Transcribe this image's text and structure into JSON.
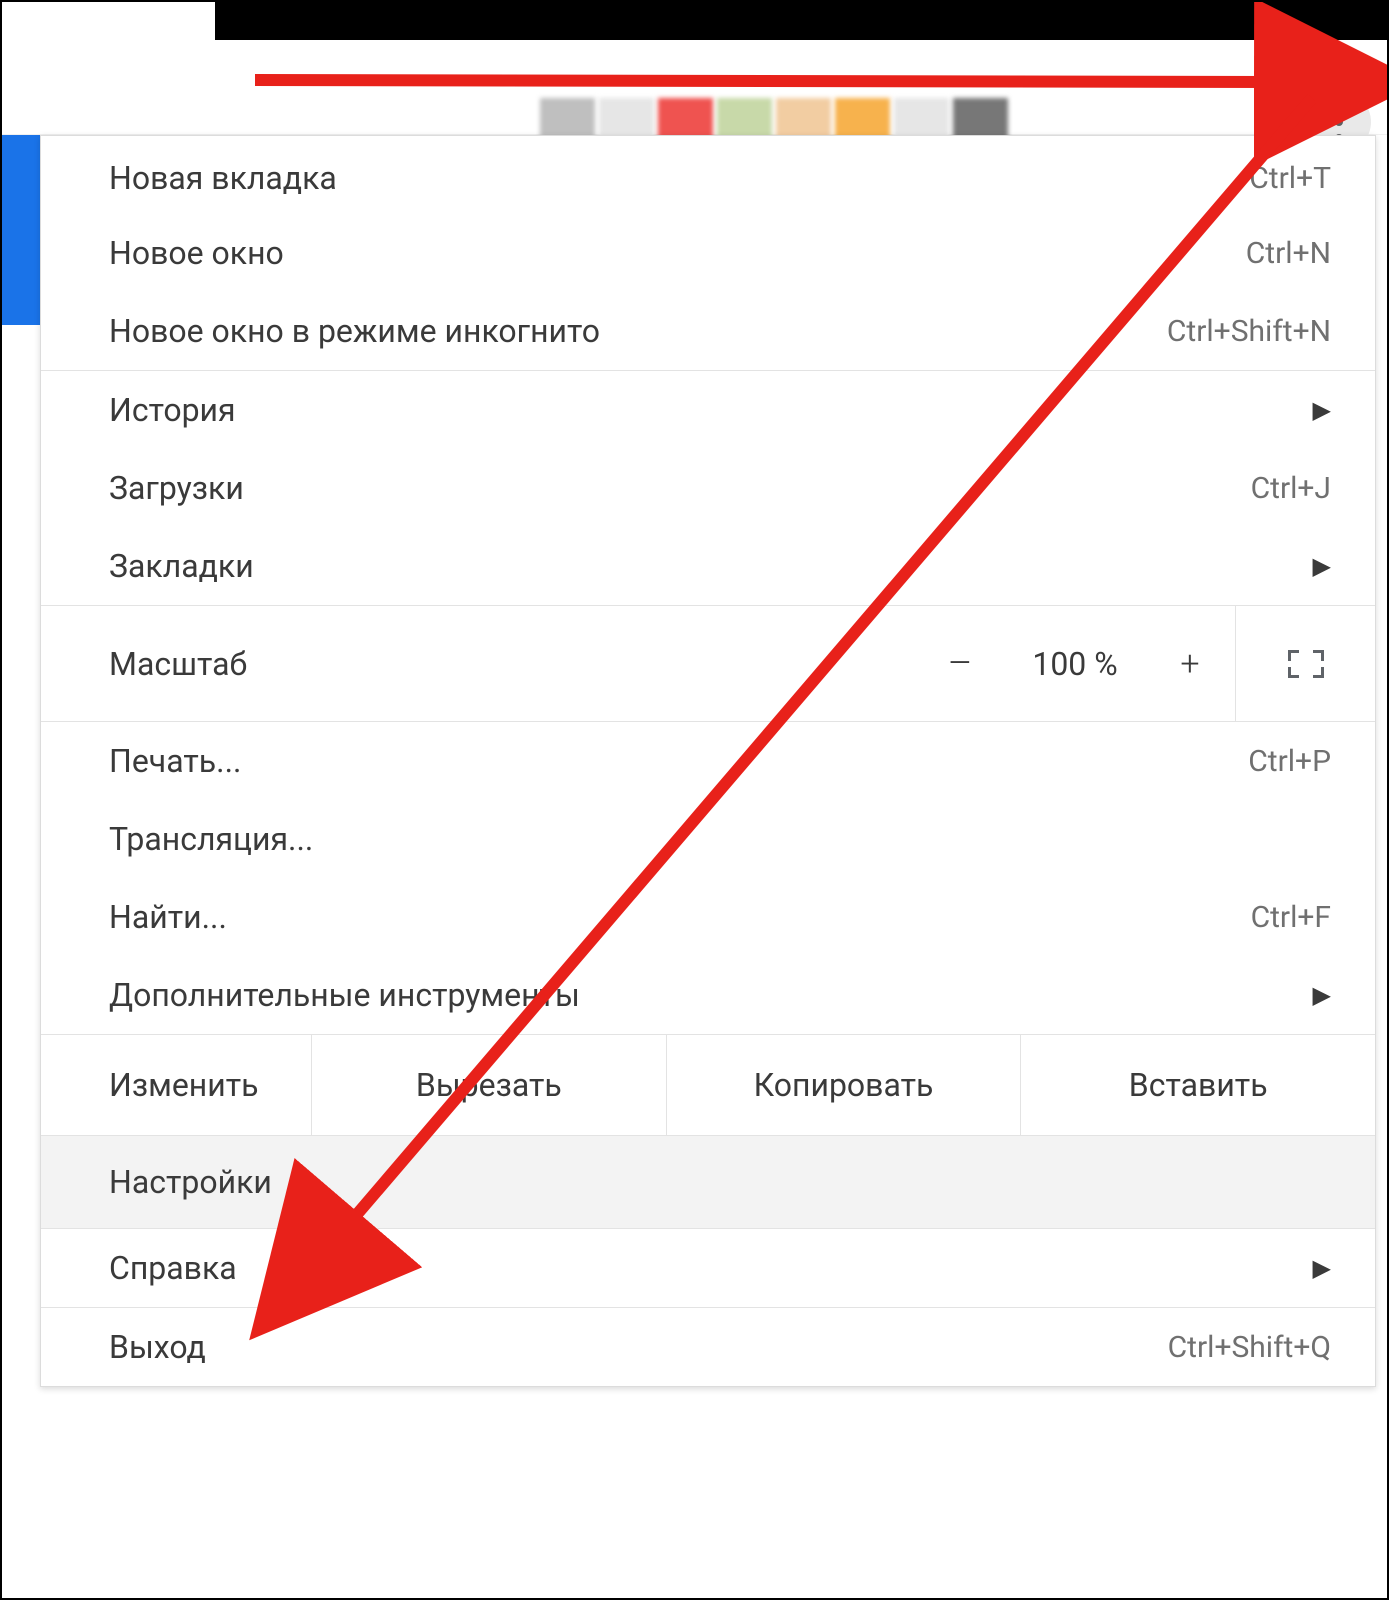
{
  "menu": {
    "new_tab": {
      "label": "Новая вкладка",
      "shortcut": "Ctrl+T"
    },
    "new_window": {
      "label": "Новое окно",
      "shortcut": "Ctrl+N"
    },
    "incognito": {
      "label": "Новое окно в режиме инкогнито",
      "shortcut": "Ctrl+Shift+N"
    },
    "history": {
      "label": "История"
    },
    "downloads": {
      "label": "Загрузки",
      "shortcut": "Ctrl+J"
    },
    "bookmarks": {
      "label": "Закладки"
    },
    "zoom": {
      "label": "Масштаб",
      "value": "100 %",
      "minus": "–",
      "plus": "+"
    },
    "print": {
      "label": "Печать...",
      "shortcut": "Ctrl+P"
    },
    "cast": {
      "label": "Трансляция..."
    },
    "find": {
      "label": "Найти...",
      "shortcut": "Ctrl+F"
    },
    "more_tools": {
      "label": "Дополнительные инструменты"
    },
    "edit": {
      "label": "Изменить",
      "cut": "Вырезать",
      "copy": "Копировать",
      "paste": "Вставить"
    },
    "settings": {
      "label": "Настройки"
    },
    "help": {
      "label": "Справка"
    },
    "exit": {
      "label": "Выход",
      "shortcut": "Ctrl+Shift+Q"
    }
  },
  "annotation": {
    "color": "#e8211a"
  }
}
